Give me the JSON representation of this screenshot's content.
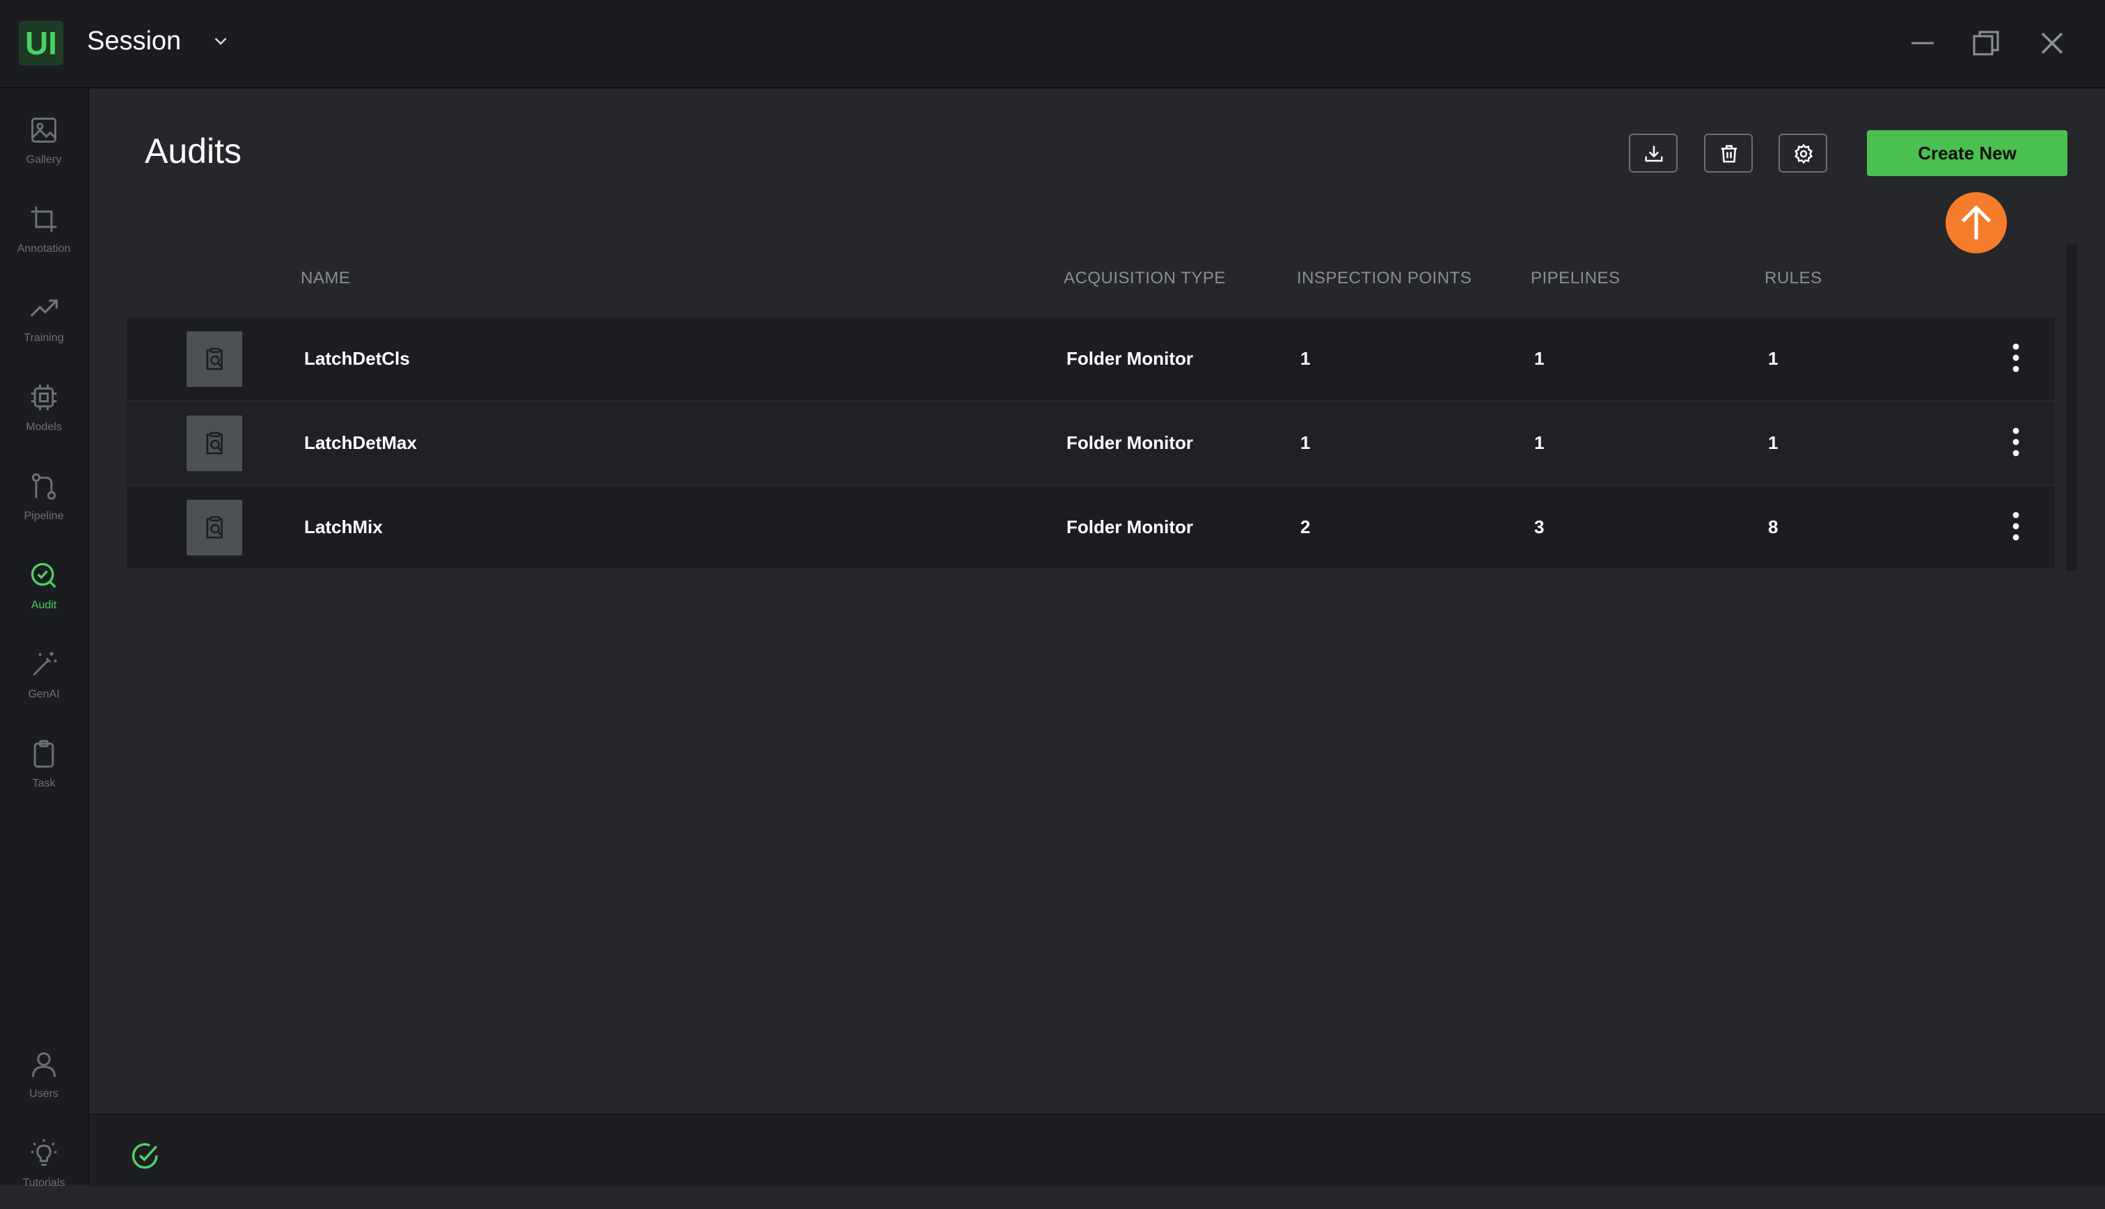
{
  "titlebar": {
    "logo_text": "UI",
    "session_label": "Session",
    "icons": [
      "chevron-down-icon",
      "minimize-icon",
      "restore-icon",
      "close-icon"
    ]
  },
  "sidebar": {
    "items": [
      {
        "label": "Gallery",
        "icon": "image-icon"
      },
      {
        "label": "Annotation",
        "icon": "crop-icon"
      },
      {
        "label": "Training",
        "icon": "trend-icon"
      },
      {
        "label": "Models",
        "icon": "chip-icon"
      },
      {
        "label": "Pipeline",
        "icon": "pipeline-icon"
      },
      {
        "label": "Audit",
        "icon": "audit-icon",
        "active": true
      },
      {
        "label": "GenAI",
        "icon": "magic-wand-icon"
      },
      {
        "label": "Task",
        "icon": "clipboard-icon"
      },
      {
        "label": "Users",
        "icon": "user-icon"
      },
      {
        "label": "Tutorials",
        "icon": "lightbulb-icon"
      }
    ]
  },
  "header": {
    "title": "Audits",
    "create_label": "Create New",
    "tool_icons": [
      "download-icon",
      "trash-icon",
      "gear-icon"
    ]
  },
  "table": {
    "columns": [
      "NAME",
      "ACQUISITION TYPE",
      "INSPECTION POINTS",
      "PIPELINES",
      "RULES"
    ],
    "rows": [
      {
        "name": "LatchDetCls",
        "acquisition": "Folder Monitor",
        "inspection_points": "1",
        "pipelines": "1",
        "rules": "1"
      },
      {
        "name": "LatchDetMax",
        "acquisition": "Folder Monitor",
        "inspection_points": "1",
        "pipelines": "1",
        "rules": "1"
      },
      {
        "name": "LatchMix",
        "acquisition": "Folder Monitor",
        "inspection_points": "2",
        "pipelines": "3",
        "rules": "8"
      }
    ]
  },
  "colors": {
    "accent": "#4bbf4f",
    "active_nav": "#4cd263",
    "highlight": "#f57c2a",
    "background": "#25272b"
  }
}
